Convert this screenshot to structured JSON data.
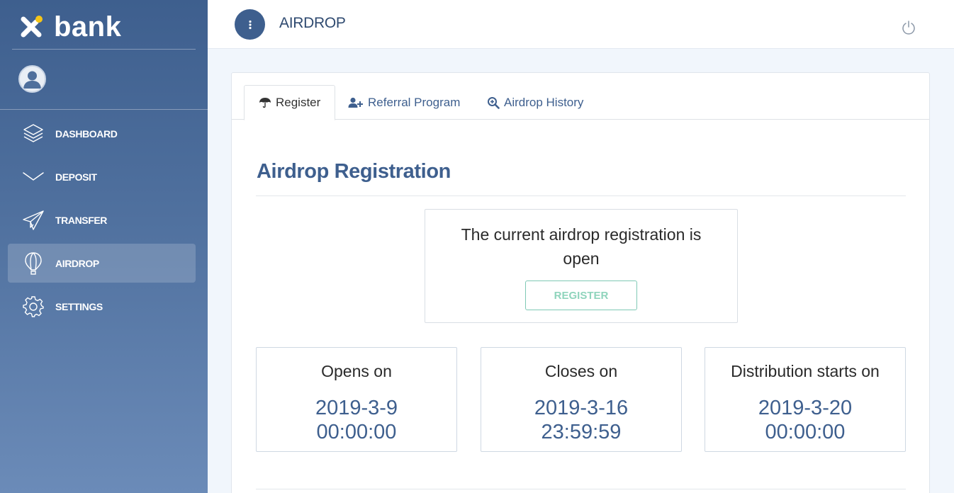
{
  "brand": {
    "name": "bank"
  },
  "header": {
    "title": "AIRDROP"
  },
  "sidebar": {
    "items": [
      {
        "label": "DASHBOARD",
        "icon": "layers-icon"
      },
      {
        "label": "DEPOSIT",
        "icon": "chevron-down-icon"
      },
      {
        "label": "TRANSFER",
        "icon": "paper-plane-icon"
      },
      {
        "label": "AIRDROP",
        "icon": "balloon-icon",
        "active": true
      },
      {
        "label": "SETTINGS",
        "icon": "gear-icon"
      }
    ]
  },
  "tabs": [
    {
      "label": "Register",
      "icon": "umbrella-icon",
      "active": true
    },
    {
      "label": "Referral Program",
      "icon": "user-plus-icon"
    },
    {
      "label": "Airdrop History",
      "icon": "search-plus-icon"
    }
  ],
  "main": {
    "section_title": "Airdrop Registration",
    "status_text": "The current airdrop registration is open",
    "register_label": "REGISTER",
    "dates": [
      {
        "label": "Opens on",
        "date": "2019-3-9",
        "time": "00:00:00"
      },
      {
        "label": "Closes on",
        "date": "2019-3-16",
        "time": "23:59:59"
      },
      {
        "label": "Distribution starts on",
        "date": "2019-3-20",
        "time": "00:00:00"
      }
    ]
  },
  "colors": {
    "primary": "#3e5f8e",
    "accent_green": "#8fd4bc",
    "logo_yellow": "#f5c518"
  }
}
